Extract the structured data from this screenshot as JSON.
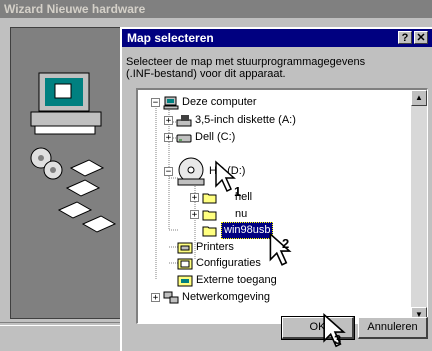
{
  "background_window": {
    "title": "Wizard Nieuwe hardware"
  },
  "dialog": {
    "title": "Map selecteren",
    "help_button": "?",
    "close_button": "✕",
    "description": "Selecteer de map met stuurprogrammagegevens\n(.INF-bestand) voor dit apparaat.",
    "ok_label": "OK",
    "cancel_label": "Annuleren"
  },
  "tree": {
    "items": [
      {
        "label": "Deze computer",
        "icon": "computer-icon",
        "expander": "−"
      },
      {
        "label": "3,5-inch diskette (A:)",
        "icon": "floppy-drive-icon",
        "expander": "+"
      },
      {
        "label": "Dell (C:)",
        "icon": "hard-drive-icon",
        "expander": "+"
      },
      {
        "label": "HP (D:)",
        "icon": "cd-drive-icon",
        "expander": "−"
      },
      {
        "label": "hell",
        "icon": "folder-icon",
        "expander": "+"
      },
      {
        "label": "nu",
        "icon": "folder-icon",
        "expander": "+"
      },
      {
        "label": "win98usb",
        "icon": "folder-icon",
        "expander": "",
        "selected": true
      },
      {
        "label": "Printers",
        "icon": "printers-icon",
        "expander": ""
      },
      {
        "label": "Configuraties",
        "icon": "control-panel-icon",
        "expander": ""
      },
      {
        "label": "Externe toegang",
        "icon": "dialup-icon",
        "expander": ""
      },
      {
        "label": "Netwerkomgeving",
        "icon": "network-icon",
        "expander": "+"
      }
    ]
  },
  "scrollbar": {
    "up": "▲",
    "down": "▼"
  },
  "step_markers": [
    "1",
    "2",
    "3"
  ],
  "colors": {
    "title_active": "#000080",
    "title_inactive": "#808080",
    "face": "#c0c0c0",
    "selection": "#000080"
  }
}
